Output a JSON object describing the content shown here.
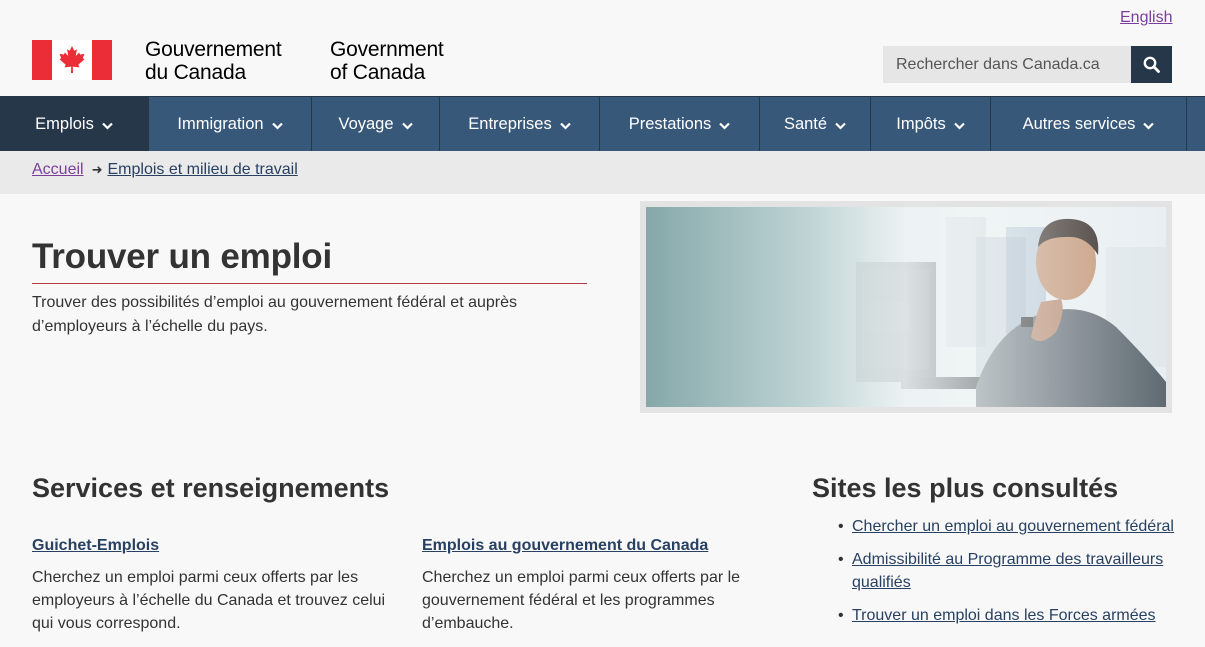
{
  "header": {
    "language_toggle": "English",
    "signature_fr_line1": "Gouvernement",
    "signature_fr_line2": "du Canada",
    "signature_en_line1": "Government",
    "signature_en_line2": "of Canada",
    "search_placeholder": "Rechercher dans Canada.ca"
  },
  "menu": {
    "items": [
      {
        "label": "Emplois"
      },
      {
        "label": "Immigration"
      },
      {
        "label": "Voyage"
      },
      {
        "label": "Entreprises"
      },
      {
        "label": "Prestations"
      },
      {
        "label": "Santé"
      },
      {
        "label": "Impôts"
      },
      {
        "label": "Autres services"
      }
    ]
  },
  "breadcrumb": {
    "home": "Accueil",
    "current": "Emplois et milieu de travail"
  },
  "main": {
    "title": "Trouver un emploi",
    "intro": "Trouver des possibilités d’emploi au gouvernement fédéral et auprès d’employeurs à l’échelle du pays."
  },
  "services": {
    "title": "Services et renseignements",
    "cards": [
      {
        "link": "Guichet-Emplois",
        "text": "Cherchez un emploi parmi ceux offerts par les employeurs à l’échelle du Canada et trouvez celui qui vous correspond."
      },
      {
        "link": "Emplois au gouvernement du Canada",
        "text": "Cherchez un emploi parmi ceux offerts par le gouvernement fédéral et les programmes d’embauche."
      }
    ]
  },
  "most_requested": {
    "title": "Sites les plus consultés",
    "links": [
      "Chercher un emploi au gouvernement fédéral",
      "Admissibilité au Programme des travailleurs qualifiés",
      "Trouver un emploi dans les Forces armées"
    ]
  },
  "colors": {
    "nav_bg": "#38587a",
    "nav_dark": "#26374a",
    "flag_red": "#eb2d37",
    "title_rule": "#af3c43",
    "link": "#284162",
    "visited_link": "#7b3f9b"
  }
}
